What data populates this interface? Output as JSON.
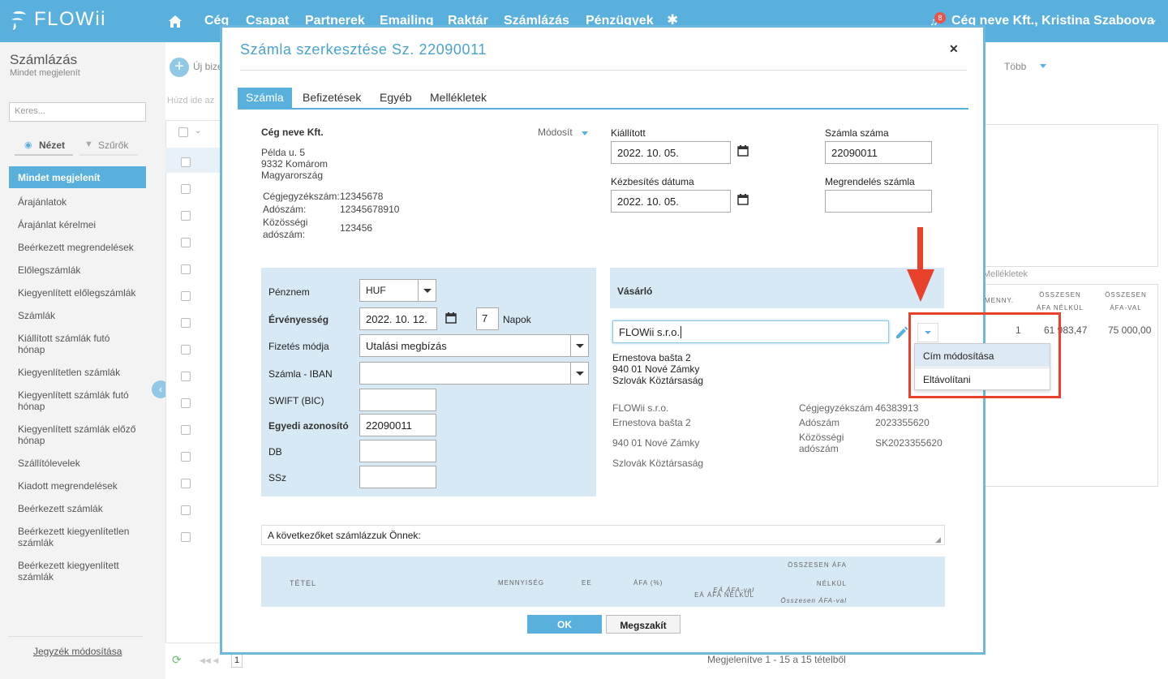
{
  "app": {
    "name": "FLOWii",
    "notif_count": "8",
    "company_user": "Cég neve Kft., Kristina Szaboova"
  },
  "nav": {
    "items": [
      "Cég",
      "Csapat",
      "Partnerek",
      "Emailing",
      "Raktár",
      "Számlázás",
      "Pénzügyek"
    ]
  },
  "sidebar": {
    "title": "Számlázás",
    "subtitle": "Mindet megjelenít",
    "search_placeholder": "Keres...",
    "tab_view": "Nézet",
    "tab_filters": "Szűrők",
    "active": "Mindet megjelenít",
    "items": [
      "Árajánlatok",
      "Árajánlat kérelmei",
      "Beérkezett megrendelések",
      "Előlegszámlák",
      "Kiegyenlített előlegszámlák",
      "Számlák",
      "Kiállított számlák futó hónap",
      "Kiegyenlítetlen számlák",
      "Kiegyenlített számlák futó hónap",
      "Kiegyenlített számlák előző hónap",
      "Szállítólevelek",
      "Kiadott megrendelések",
      "Beérkezett számlák",
      "Beérkezett kiegyenlítetlen számlák",
      "Beérkezett kiegyenlített számlák"
    ],
    "footer_link": "Jegyzék módosítása"
  },
  "background": {
    "new_button": "Új bize",
    "drag_hint": "Húzd ide az",
    "more": "Több",
    "attachments": "Mellékletek",
    "col_qty": "MENNY.",
    "col_net": "ÖSSZESEN ÁFA NÉLKÜL",
    "col_gross": "ÖSSZESEN ÁFA-VAL",
    "row_qty": "1",
    "row_net": "61 983,47",
    "row_gross": "75 000,00",
    "pager_page": "1",
    "pager_info": "Megjelenítve 1 - 15 a 15 tételből"
  },
  "dialog": {
    "title": "Számla szerkesztése Sz. 22090011",
    "tabs": [
      "Számla",
      "Befizetések",
      "Egyéb",
      "Mellékletek"
    ],
    "seller": {
      "name": "Cég neve Kft.",
      "modify": "Módosít",
      "street": "Példa u. 5",
      "city": "9332 Komárom",
      "country": "Magyarország",
      "reg_label": "Cégjegyzékszám:",
      "reg_value": "12345678",
      "tax_label": "Adószám:",
      "tax_value": "12345678910",
      "eu_label": "Közösségi adószám:",
      "eu_value": "123456"
    },
    "issued_label": "Kiállított",
    "issued_value": "2022. 10. 05.",
    "delivery_label": "Kézbesítés dátuma",
    "delivery_value": "2022. 10. 05.",
    "invoice_no_label": "Számla száma",
    "invoice_no_value": "22090011",
    "order_no_label": "Megrendelés számla",
    "order_no_value": "",
    "payment": {
      "currency_label": "Pénznem",
      "currency_value": "HUF",
      "validity_label": "Érvényesség",
      "validity_value": "2022. 10. 12.",
      "days_value": "7",
      "days_label": "Napok",
      "method_label": "Fizetés módja",
      "method_value": "Utalási megbízás",
      "iban_label": "Számla - IBAN",
      "iban_value": "",
      "swift_label": "SWIFT (BIC)",
      "swift_value": "",
      "uid_label": "Egyedi azonosító",
      "uid_value": "22090011",
      "db_label": "DB",
      "db_value": "",
      "ssz_label": "SSz",
      "ssz_value": ""
    },
    "buyer": {
      "header": "Vásárló",
      "name_value": "FLOWii s.r.o.",
      "street": "Ernestova bašta 2",
      "city": "940 01 Nové Zámky",
      "country": "Szlovák Köztársaság",
      "menu": [
        "Cím módosítása",
        "Eltávolítani"
      ],
      "detail_name": "FLOWii s.r.o.",
      "detail_street": "Ernestova bašta 2",
      "detail_city": "940 01 Nové Zámky",
      "detail_country": "Szlovák Köztársaság",
      "reg_label": "Cégjegyzékszám",
      "reg_value": "46383913",
      "tax_label": "Adószám",
      "tax_value": "2023355620",
      "eu_label": "Közösségi adószám",
      "eu_value": "SK2023355620"
    },
    "intro_text": "A következőket számlázzuk Önnek:",
    "items_table": {
      "col_item": "TÉTEL",
      "col_qty": "MENNYISÉG",
      "col_unit": "EE",
      "col_vat": "ÁFA (%)",
      "col_unit_net": "EÁ ÁFA NÉLKÜL",
      "col_unit_gross": "EÁ ÁFA-val",
      "col_total_net_1": "ÖSSZESEN ÁFA",
      "col_total_net_2": "NÉLKÜL",
      "col_total_gross": "Összesen ÁFA-val"
    },
    "ok": "OK",
    "cancel": "Megszakít"
  },
  "colors": {
    "accent": "#5ab0dd",
    "highlight": "#e8412c"
  }
}
